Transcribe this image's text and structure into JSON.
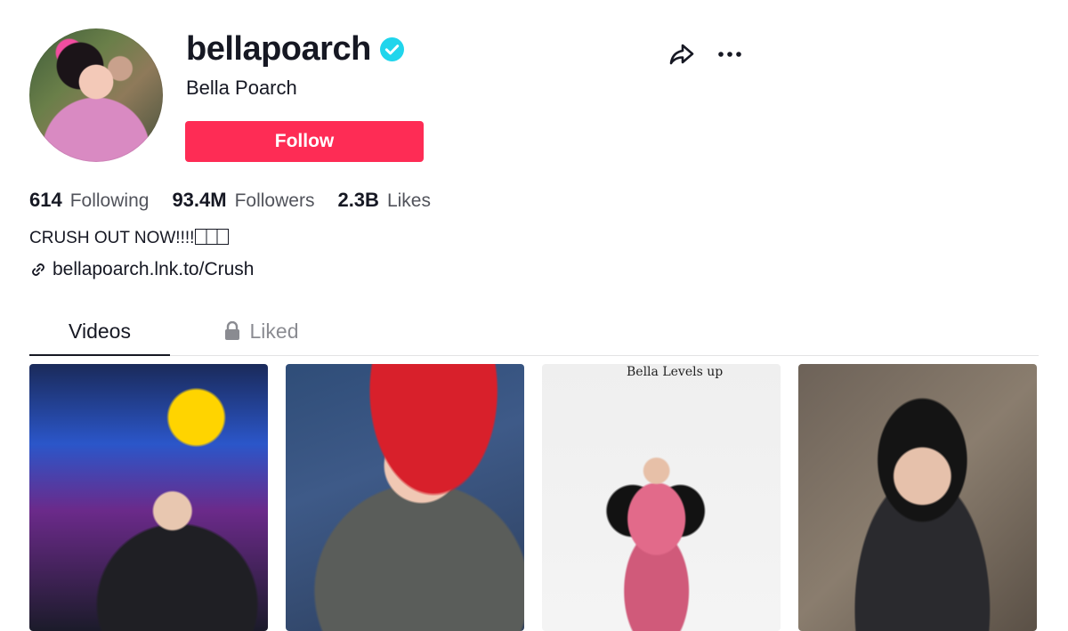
{
  "profile": {
    "username": "bellapoarch",
    "display_name": "Bella Poarch",
    "verified_icon": "verified-check-icon",
    "follow_label": "Follow",
    "stats": [
      {
        "num": "614",
        "label": "Following"
      },
      {
        "num": "93.4M",
        "label": "Followers"
      },
      {
        "num": "2.3B",
        "label": "Likes"
      }
    ],
    "bio": "CRUSH OUT NOW!!!!",
    "link": "bellapoarch.lnk.to/Crush"
  },
  "actions": {
    "share_icon": "share-icon",
    "more_icon": "more-icon"
  },
  "tabs": [
    {
      "label": "Videos",
      "active": true
    },
    {
      "label": "Liked",
      "active": false,
      "icon": "lock-icon"
    }
  ],
  "videos": [
    {
      "caption": ""
    },
    {
      "caption": ""
    },
    {
      "caption": "Bella Levels up"
    },
    {
      "caption": ""
    }
  ],
  "colors": {
    "accent": "#fe2c55",
    "verified": "#20d5ec",
    "text": "#161823"
  }
}
